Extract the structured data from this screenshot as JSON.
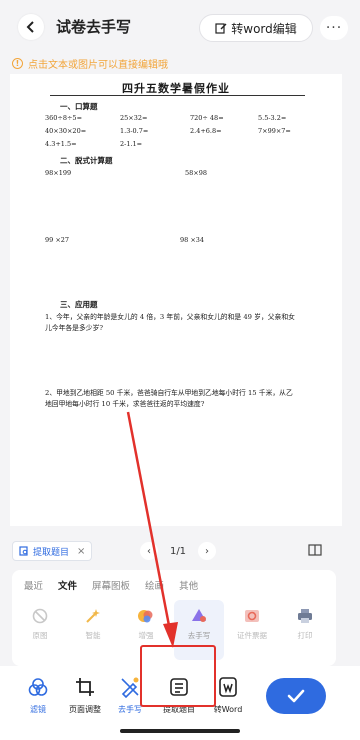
{
  "header": {
    "title": "试卷去手写",
    "to_word_label": "转word编辑",
    "more_label": "···"
  },
  "tip": {
    "text": "点击文本或图片可以直接编辑哦",
    "icon_text": "!"
  },
  "document": {
    "title": "四升五数学暑假作业",
    "section1": "一、口算题",
    "oral": [
      [
        "360÷8÷5=",
        "25×32=",
        "720÷ 48=",
        "5.5-3.2="
      ],
      [
        "40×30×20=",
        "1.3-0.7=",
        "2.4+6.8=",
        "7×99×7="
      ],
      [
        "4.3+1.5=",
        "2-1.1=",
        "",
        ""
      ]
    ],
    "section2": "二、脱式计算题",
    "calc": [
      "98×199",
      "58×98",
      "99 ×27",
      "98 ×34"
    ],
    "section3": "三、应用题",
    "q1": "1、今年，父亲的年龄是女儿的 4 倍，3 年前，父亲和女儿的和是 49 岁，父亲和女儿今年各是多少岁?",
    "q2": "2、甲地到乙地相距 50 千米，爸爸骑自行车从甲地到乙地每小时行 15 千米，从乙地回甲地每小时行 10 千米，求爸爸往返的平均速度?"
  },
  "panel": {
    "chip_label": "提取题目",
    "chip_close": "×",
    "page_text": "1/1",
    "prev": "‹",
    "next": "›",
    "tabs": [
      "最近",
      "文件",
      "屏幕图板",
      "绘画",
      "其他"
    ],
    "active_tab_index": 1,
    "tools": [
      "原图",
      "智能",
      "增强",
      "去手写",
      "证件票据",
      "打印"
    ],
    "selected_tool_index": 3
  },
  "bottom_bar": {
    "items": [
      "滤镜",
      "页面调整",
      "去手写",
      "提取题目",
      "转Word"
    ]
  },
  "colors": {
    "accent": "#2f6be0",
    "highlight": "#e2312b",
    "tip": "#f2a53a"
  }
}
